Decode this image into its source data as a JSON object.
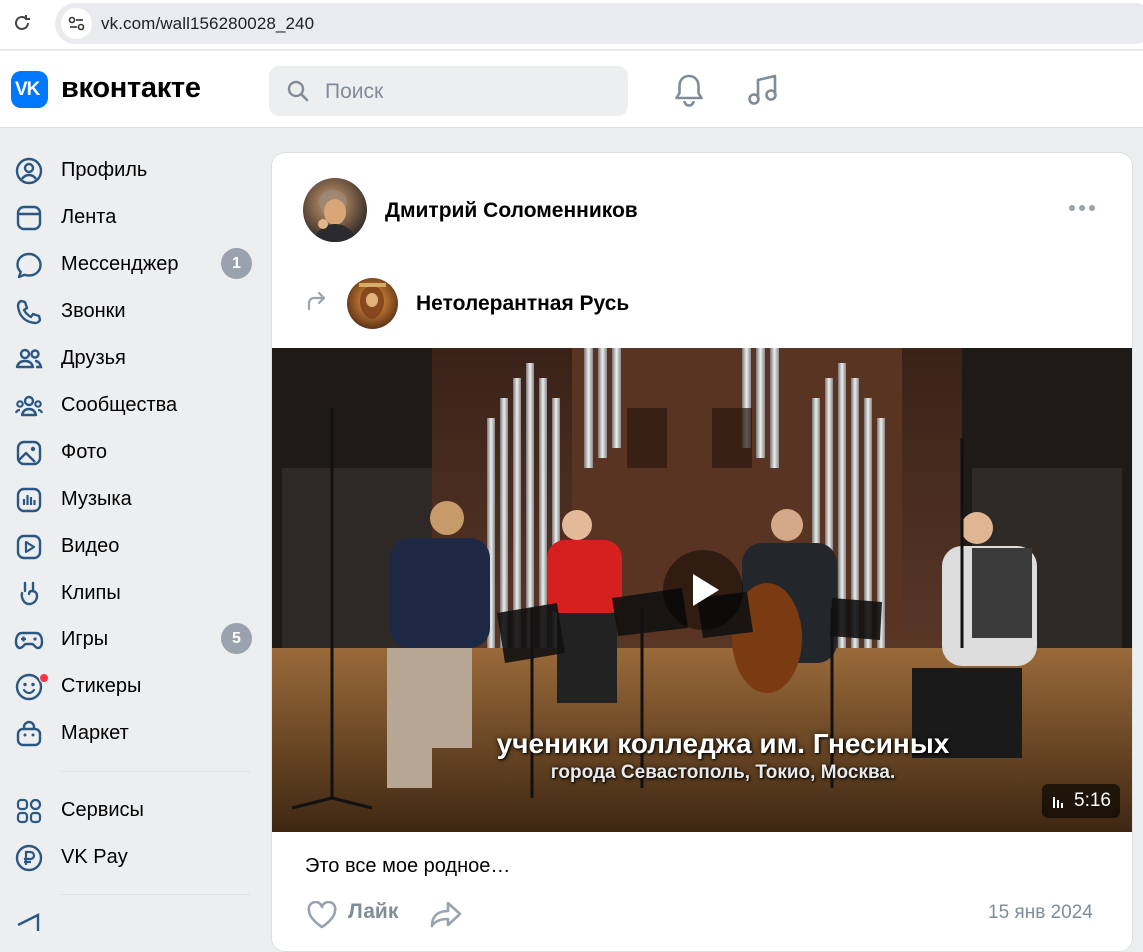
{
  "browser": {
    "url": "vk.com/wall156280028_240"
  },
  "header": {
    "logo_mark": "VK",
    "logo_text": "вконтакте",
    "search_placeholder": "Поиск",
    "icons": [
      "bell-icon",
      "music-note-icon"
    ]
  },
  "sidebar": {
    "items": [
      {
        "label": "Профиль",
        "icon": "profile-icon"
      },
      {
        "label": "Лента",
        "icon": "feed-icon"
      },
      {
        "label": "Мессенджер",
        "icon": "messenger-icon",
        "badge": "1"
      },
      {
        "label": "Звонки",
        "icon": "phone-icon"
      },
      {
        "label": "Друзья",
        "icon": "friends-icon"
      },
      {
        "label": "Сообщества",
        "icon": "communities-icon"
      },
      {
        "label": "Фото",
        "icon": "photo-icon"
      },
      {
        "label": "Музыка",
        "icon": "music-icon"
      },
      {
        "label": "Видео",
        "icon": "video-icon"
      },
      {
        "label": "Клипы",
        "icon": "clips-icon"
      },
      {
        "label": "Игры",
        "icon": "games-icon",
        "badge": "5"
      },
      {
        "label": "Стикеры",
        "icon": "stickers-icon"
      },
      {
        "label": "Маркет",
        "icon": "market-icon"
      },
      {
        "label": "Сервисы",
        "icon": "services-icon"
      },
      {
        "label": "VK Pay",
        "icon": "vkpay-icon"
      }
    ]
  },
  "post": {
    "author": "Дмитрий Соломенников",
    "repost_source": "Нетолерантная Русь",
    "video": {
      "caption_line1": "ученики колледжа им. Гнесиных",
      "caption_line2": "города Севастополь, Токио, Москва.",
      "duration": "5:16"
    },
    "text": "Это все мое родное…",
    "like_label": "Лайк",
    "date": "15 янв 2024"
  },
  "colors": {
    "brand": "#0077ff",
    "page_bg": "#edeef0",
    "icon_blue": "#2a5885",
    "muted": "#818c99"
  }
}
